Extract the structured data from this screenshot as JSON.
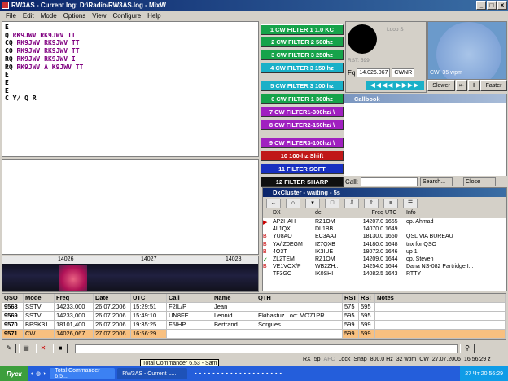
{
  "window": {
    "title": "RW3AS - Current log: D:\\Radio\\RW3AS.log - MixW"
  },
  "menu": [
    "File",
    "Edit",
    "Mode",
    "Options",
    "View",
    "Configure",
    "Help"
  ],
  "rx_lines": [
    {
      "a": "E",
      "b": ""
    },
    {
      "a": "Q ",
      "b": "RK9JWV RK9JWV TT"
    },
    {
      "a": "CQ ",
      "b": "RK9JWV RK9JWV TT"
    },
    {
      "a": "CO ",
      "b": "RK9JWV RK9JWV TT"
    },
    {
      "a": "RQ ",
      "b": "RK9JWV RK9JWV I"
    },
    {
      "a": "RQ ",
      "b": "RK9JWV A K9JWV TT"
    },
    {
      "a": "E",
      "b": ""
    },
    {
      "a": "E",
      "b": ""
    },
    {
      "a": "E",
      "b": ""
    },
    {
      "a": "C Y/ Q R",
      "b": ""
    }
  ],
  "waterfall": {
    "ticks": [
      "14026",
      "14027",
      "14028"
    ]
  },
  "filters": [
    {
      "label": "1  CW FILTER 1  1.0 KC",
      "color": "#16a34a"
    },
    {
      "label": "2  CW FILTER 2 500hz",
      "color": "#16a34a"
    },
    {
      "label": "3  CW FILTER 3 250hz",
      "color": "#16a34a"
    },
    {
      "label": "4  CW FILTER 3 150 hz",
      "color": "#1ab0c8"
    },
    {
      "label": "5  CW FILTER 3 100 hz",
      "color": "#1ab0c8"
    },
    {
      "label": "6  CW FILTER 1 300hz",
      "color": "#16a34a"
    },
    {
      "label": "7  CW FILTER1-300hz/ \\",
      "color": "#a020c0"
    },
    {
      "label": "8  CW FILTER2-150hz/ \\",
      "color": "#a020c0"
    },
    {
      "label": "9  CW FILTER3-100hz/ \\",
      "color": "#a020c0"
    },
    {
      "label": "10     100-hz Shift",
      "color": "#c01818"
    },
    {
      "label": "11     FILTER SOFT",
      "color": "#1830c0"
    },
    {
      "label": "12  FILTER SHARP",
      "color": "#101010"
    }
  ],
  "meter": {
    "lbl1": "Loop S",
    "lbl2": "RST: 599",
    "freq": "14.026.067",
    "mode": "CWNR",
    "fq": "Fq",
    "arrows": "◀◀◀◀ ▶▶▶▶"
  },
  "radar": {
    "speed": "CW: 35 wpm",
    "slower": "Slower",
    "faster": "Faster"
  },
  "callbook": {
    "title": "Callbook",
    "call_label": "Call:",
    "search": "Search...",
    "close": "Close"
  },
  "dxcluster": {
    "title": "DxCluster - waiting - 5s",
    "headers": [
      "DX",
      "de",
      "Freq",
      "UTC",
      "Info"
    ],
    "rows": [
      {
        "dx": "AP2HAH",
        "de": "RZ1OM",
        "freq": "14207.0",
        "utc": "1655",
        "info": "op. Ahmad"
      },
      {
        "dx": "4L1QX",
        "de": "DL1BB...",
        "freq": "14070.0",
        "utc": "1649",
        "info": ""
      },
      {
        "dx": "YU8AO",
        "de": "EC3AAJ",
        "freq": "18130.0",
        "utc": "1650",
        "info": "QSL VIA BUREAU"
      },
      {
        "dx": "YA/IZ0EGM",
        "de": "IZ7QXB",
        "freq": "14180.0",
        "utc": "1648",
        "info": "tnx for QSO"
      },
      {
        "dx": "4O3T",
        "de": "IK3IUE",
        "freq": "18072.0",
        "utc": "1646",
        "info": "up 1"
      },
      {
        "dx": "ZL2TEM",
        "de": "RZ1OM",
        "freq": "14209.0",
        "utc": "1644",
        "info": "op. Steven"
      },
      {
        "dx": "VE1VOX/P",
        "de": "WB2ZH...",
        "freq": "14254.0",
        "utc": "1644",
        "info": "Dana NS-082 Partridge I..."
      },
      {
        "dx": "TF3GC",
        "de": "IK0SHI",
        "freq": "14082.5",
        "utc": "1643",
        "info": "RTTY"
      }
    ]
  },
  "log": {
    "headers": [
      "QSO",
      "Mode",
      "Freq",
      "Date",
      "UTC",
      "Call",
      "Name",
      "QTH",
      "RST",
      "RS!",
      "Notes"
    ],
    "rows": [
      [
        "9568",
        "SSTV",
        "14233,000",
        "26.07.2006",
        "15:29:51",
        "F2IL/P",
        "Jean",
        "",
        "575",
        "595",
        ""
      ],
      [
        "9569",
        "SSTV",
        "14233,000",
        "26.07.2006",
        "15:49:10",
        "UN8FE",
        "Leonid",
        "Ekibastuz Loc: MO71PR",
        "595",
        "595",
        ""
      ],
      [
        "9570",
        "BPSK31",
        "18101,400",
        "26.07.2006",
        "19:35:25",
        "F5IHP",
        "Bertrand",
        "Sorgues",
        "599",
        "599",
        ""
      ],
      [
        "9571",
        "CW",
        "14026,067",
        "27.07.2006",
        "16:56:29",
        "",
        "",
        "",
        "599",
        "599",
        ""
      ]
    ]
  },
  "status": [
    "RX",
    "5p",
    "AFC",
    "Lock",
    "Snap",
    "800,0 Hz",
    "32 wpm",
    "CW",
    "27.07.2006",
    "16:56:29 z"
  ],
  "tooltip": "Total Commander 6.53 - Sam",
  "taskbar": {
    "start": "Пуск",
    "tasks": [
      "Total Commander 6.5...",
      "RW3AS - Current L..."
    ],
    "clock": "27 Чт 20:56:29"
  }
}
